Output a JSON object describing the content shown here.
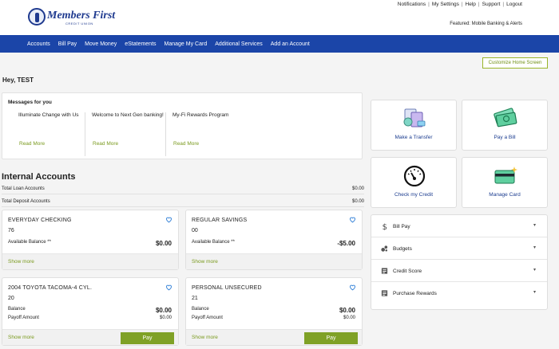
{
  "header": {
    "logo_text": "Members First",
    "logo_sub": "CREDIT UNION",
    "util_links": [
      "Notifications",
      "My Settings",
      "Help",
      "Support",
      "Logout"
    ],
    "featured_label": "Featured:",
    "featured_link": "Mobile Banking & Alerts"
  },
  "nav": [
    "Accounts",
    "Bill Pay",
    "Move Money",
    "eStatements",
    "Manage My Card",
    "Additional Services",
    "Add an Account"
  ],
  "customize_label": "Customize Home Screen",
  "greeting": "Hey, TEST",
  "messages": {
    "title": "Messages for you",
    "items": [
      {
        "text": "Illuminate Change with Us",
        "link": "Read More"
      },
      {
        "text": "Welcome to Next Gen banking!",
        "link": "Read More"
      },
      {
        "text": "My-Fi Rewards Program",
        "link": "Read More"
      }
    ]
  },
  "internal": {
    "title": "Internal Accounts",
    "totals": [
      {
        "label": "Total Loan Accounts",
        "value": "$0.00"
      },
      {
        "label": "Total Deposit Accounts",
        "value": "$0.00"
      }
    ]
  },
  "accounts": [
    {
      "name": "EVERYDAY CHECKING",
      "number": "76",
      "line1_label": "Available Balance **",
      "line1_value": "$0.00",
      "show_more": "Show more"
    },
    {
      "name": "REGULAR SAVINGS",
      "number": "00",
      "line1_label": "Available Balance **",
      "line1_value": "-$5.00",
      "show_more": "Show more"
    },
    {
      "name": "2004 TOYOTA TACOMA-4 CYL.",
      "number": "20",
      "line1_label": "Balance",
      "line1_value": "$0.00",
      "line2_label": "Payoff Amount",
      "line2_value": "$0.00",
      "show_more": "Show more",
      "pay": "Pay"
    },
    {
      "name": "PERSONAL UNSECURED",
      "number": "21",
      "line1_label": "Balance",
      "line1_value": "$0.00",
      "line2_label": "Payoff Amount",
      "line2_value": "$0.00",
      "show_more": "Show more",
      "pay": "Pay"
    }
  ],
  "tiles": [
    "Make a Transfer",
    "Pay a Bill",
    "Check my Credit",
    "Manage Card"
  ],
  "accordion": [
    "Bill Pay",
    "Budgets",
    "Credit Score",
    "Purchase Rewards"
  ],
  "colors": {
    "nav_blue": "#1b45a8",
    "accent_green": "#7fa126",
    "link_green": "#7a9a1e"
  }
}
